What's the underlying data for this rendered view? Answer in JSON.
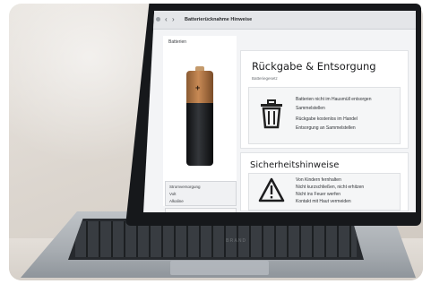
{
  "browser": {
    "url_text": "Batterierücknahme Hinweise",
    "back_glyph": "‹",
    "forward_glyph": "›"
  },
  "product": {
    "breadcrumb": "Batterien",
    "spec_line_1": "Stromversorgung",
    "spec_line_2": "Volt",
    "spec_line_3": "Alkaline",
    "battery_colors": {
      "top": "#c88a55",
      "body": "#1a1b1e"
    }
  },
  "return_section": {
    "title": "Rückgabe & Entsorgung",
    "subtitle": "Batteriegesetz",
    "icon": "trash-bin-icon",
    "lines": [
      "Batterien nicht im Hausmüll entsorgen",
      "Sammelstellen",
      "Rückgabe kostenlos im Handel",
      "Entsorgung an Sammelstellen"
    ]
  },
  "safety_section": {
    "title": "Sicherheitshinweise",
    "icon": "warning-triangle-icon",
    "lines": [
      "Von Kindern fernhalten",
      "Nicht kurzschließen, nicht erhitzen",
      "Nicht ins Feuer werfen",
      "Kontakt mit Haut vermeiden"
    ]
  },
  "laptop": {
    "brand": "BRAND"
  }
}
